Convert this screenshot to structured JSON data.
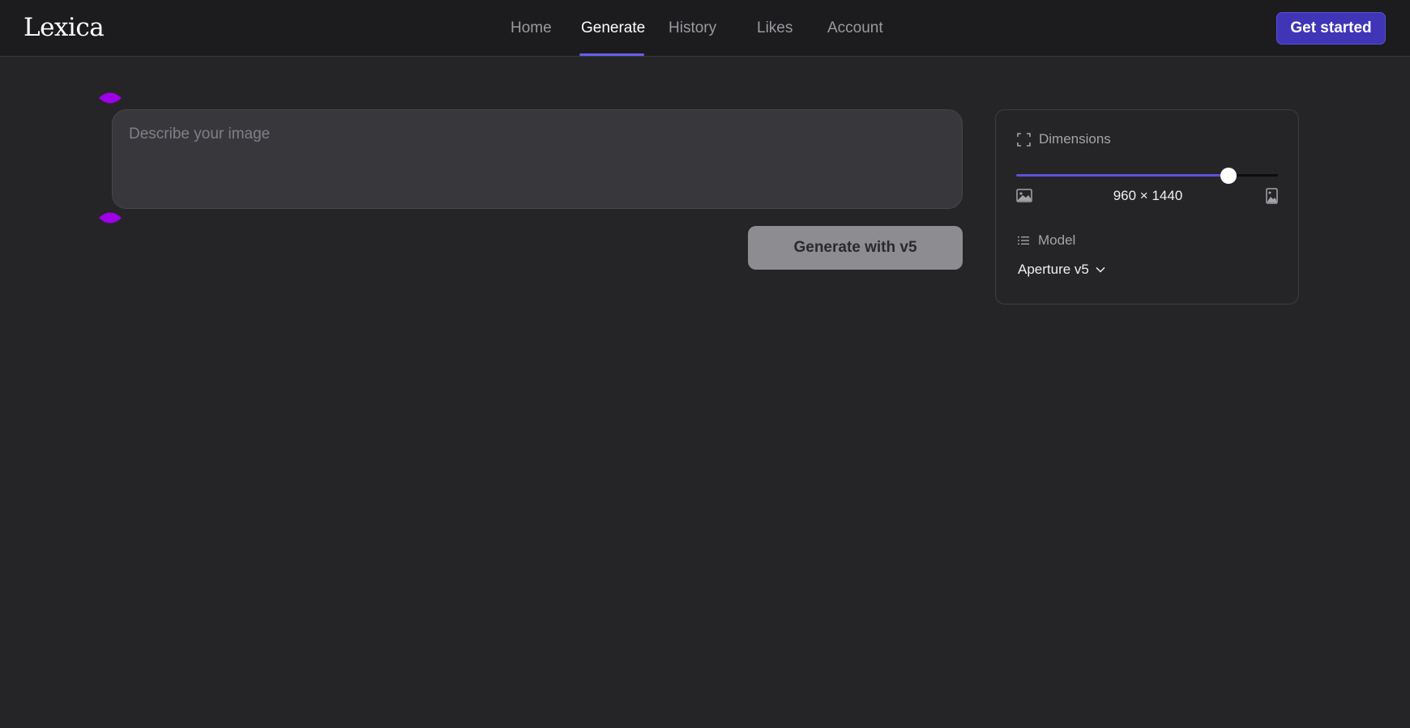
{
  "app": {
    "logo": "Lexica"
  },
  "nav": {
    "items": [
      {
        "label": "Home",
        "active": false
      },
      {
        "label": "Generate",
        "active": true
      },
      {
        "label": "History",
        "active": false
      },
      {
        "label": "Likes",
        "active": false
      },
      {
        "label": "Account",
        "active": false
      }
    ]
  },
  "header": {
    "cta_label": "Get started"
  },
  "prompt": {
    "placeholder": "Describe your image",
    "value": ""
  },
  "generate": {
    "label": "Generate with v5"
  },
  "settings": {
    "dimensions_label": "Dimensions",
    "dimensions_value": "960 × 1440",
    "slider_fraction": 0.81,
    "model_label": "Model",
    "model_value": "Aperture v5"
  },
  "icons": {
    "dimensions": "expand-frame-icon",
    "landscape": "landscape-image-icon",
    "portrait": "portrait-image-icon",
    "model": "list-icon",
    "chevron": "chevron-down-icon",
    "marker": "resize-handle-icon"
  },
  "colors": {
    "accent": "#6a5cf0",
    "cta": "#3f35b6",
    "marker": "#a000e8",
    "background": "#252527"
  }
}
